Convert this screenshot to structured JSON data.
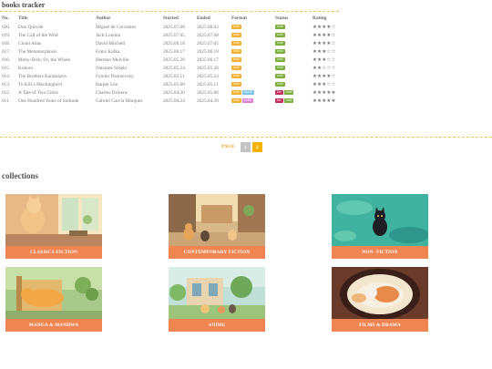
{
  "tracker": {
    "title": "books tracker",
    "headers": [
      "No.",
      "Title",
      "Author",
      "Started",
      "Ended",
      "Format",
      "Status",
      "Rating"
    ],
    "rows": [
      {
        "no": "020.",
        "title": "Don Quixote",
        "author": "Miguel de Cervantes",
        "started": "2025.07.08",
        "ended": "2025.08.02",
        "format": [
          "read"
        ],
        "status": [
          "read"
        ],
        "rating": "★★★★☆"
      },
      {
        "no": "019.",
        "title": "The Call of the Wild",
        "author": "Jack London",
        "started": "2025.07.05",
        "ended": "2025.07.08",
        "format": [
          "read"
        ],
        "status": [
          "read"
        ],
        "rating": "★★★★☆"
      },
      {
        "no": "018.",
        "title": "Cloud Atlas",
        "author": "David Mitchell",
        "started": "2025.06.18",
        "ended": "2025.07.05",
        "format": [
          "read"
        ],
        "status": [
          "read"
        ],
        "rating": "★★★★☆"
      },
      {
        "no": "017.",
        "title": "The Metamorphosis",
        "author": "Franz Kafka",
        "started": "2025.06.17",
        "ended": "2025.06.18",
        "format": [
          "read"
        ],
        "status": [
          "read"
        ],
        "rating": "★★★☆☆"
      },
      {
        "no": "016.",
        "title": "Moby-Dick; Or, the Whale",
        "author": "Herman Melville",
        "started": "2025.05.26",
        "ended": "2025.06.17",
        "format": [
          "read"
        ],
        "status": [
          "read"
        ],
        "rating": "★★★☆☆"
      },
      {
        "no": "015.",
        "title": "Kokoro",
        "author": "Natsume Sōseki",
        "started": "2025.05.24",
        "ended": "2025.05.26",
        "format": [
          "read"
        ],
        "status": [
          "read"
        ],
        "rating": "★★☆☆☆"
      },
      {
        "no": "014.",
        "title": "The Brothers Karamazov",
        "author": "Fyodor Dostoevsky",
        "started": "2025.05.11",
        "ended": "2025.05.24",
        "format": [
          "read"
        ],
        "status": [
          "read"
        ],
        "rating": "★★★★☆"
      },
      {
        "no": "013.",
        "title": "To Kill a Mockingbird",
        "author": "Harper Lee",
        "started": "2025.05.06",
        "ended": "2025.05.11",
        "format": [
          "read"
        ],
        "status": [
          "read"
        ],
        "rating": "★★★☆☆"
      },
      {
        "no": "012.",
        "title": "A Tale of Two Cities",
        "author": "Charles Dickens",
        "started": "2025.04.30",
        "ended": "2025.05.06",
        "format": [
          "read",
          "ebook"
        ],
        "status": [
          "fav",
          "read"
        ],
        "rating": "★★★★★"
      },
      {
        "no": "011.",
        "title": "One Hundred Years of Solitude",
        "author": "Gabriel García Márquez",
        "started": "2025.04.24",
        "ended": "2025.04.30",
        "format": [
          "read",
          "audio"
        ],
        "status": [
          "fav",
          "read"
        ],
        "rating": "★★★★★"
      }
    ],
    "tag_colors": {
      "read": "#f2b134",
      "ebook": "#7ec3e8",
      "audio": "#e07fdc",
      "fav": "#c0305a",
      "status_read": "#7aaf3c"
    }
  },
  "pagination": {
    "label": "PAGE",
    "pages": [
      "1",
      "2"
    ],
    "current": "2",
    "colors": {
      "inactive": "#c4c4c4",
      "active": "#f5b300"
    }
  },
  "collections": {
    "title": "collections",
    "items": [
      {
        "label": "CLASSICS FICTION"
      },
      {
        "label": "CONTEMPORARY FICTION"
      },
      {
        "label": "NON- FICTION"
      },
      {
        "label": "MANGA & MANHWA"
      },
      {
        "label": "ANIME"
      },
      {
        "label": "FILMS & DRAMA"
      }
    ],
    "caption_color": "#f08552"
  }
}
